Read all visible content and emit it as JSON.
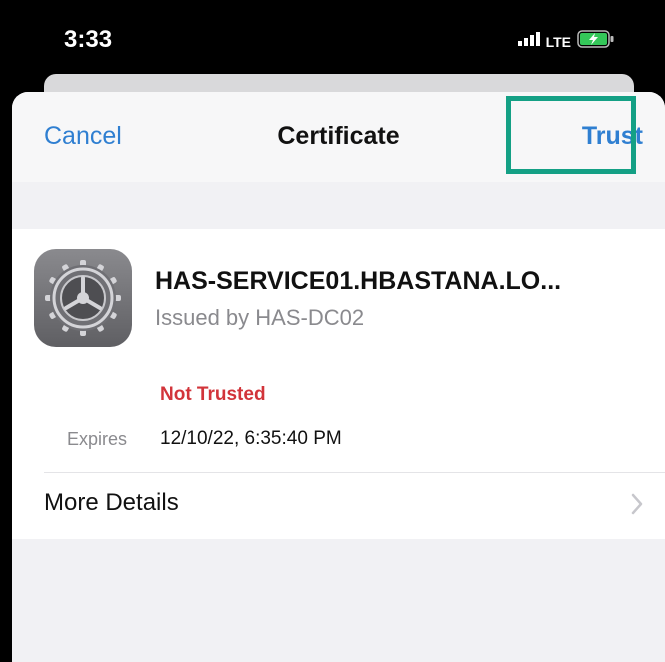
{
  "status_bar": {
    "time": "3:33",
    "network": "LTE"
  },
  "nav": {
    "cancel_label": "Cancel",
    "title": "Certificate",
    "trust_label": "Trust"
  },
  "certificate": {
    "name": "HAS-SERVICE01.HBASTANA.LO...",
    "issuer": "Issued by HAS-DC02",
    "status": "Not Trusted",
    "expires_label": "Expires",
    "expires_value": "12/10/22, 6:35:40 PM"
  },
  "more_details_label": "More Details",
  "icons": {
    "app_icon": "settings-gear-icon",
    "chevron": "chevron-right-icon",
    "signal": "signal-bars-icon",
    "battery": "battery-charging-icon"
  },
  "colors": {
    "accent": "#2f7fd1",
    "not_trusted": "#d2343a",
    "highlight": "#14a085",
    "battery": "#34c759"
  }
}
